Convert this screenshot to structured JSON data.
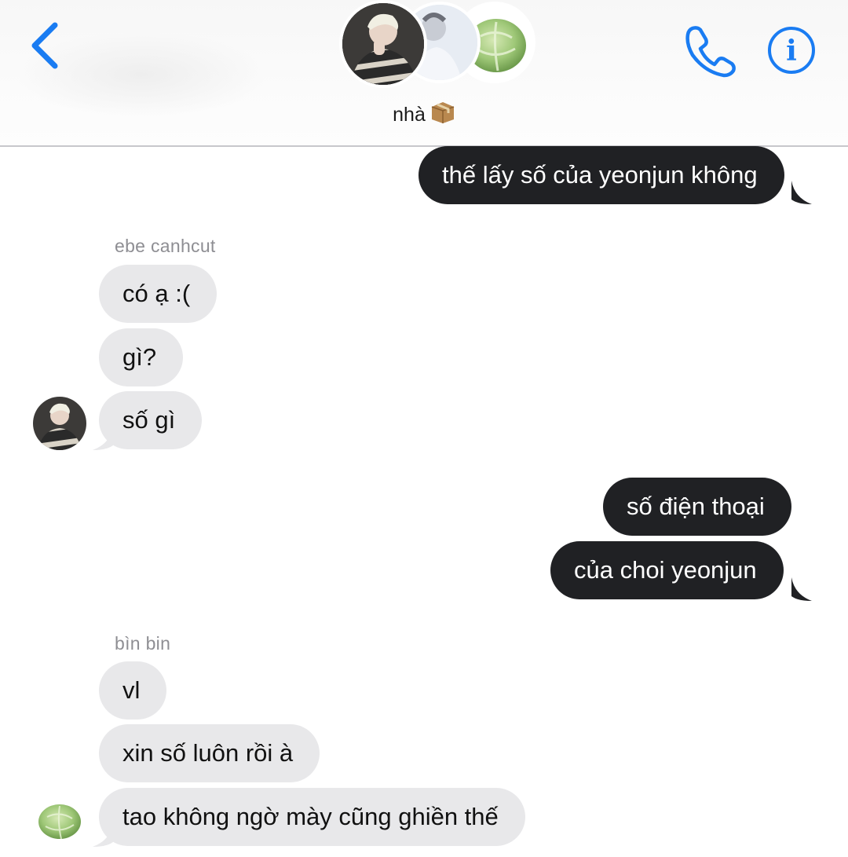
{
  "header": {
    "group_name": "nhà",
    "group_emoji": "📦",
    "back_icon": "chevron-left-icon",
    "call_icon": "phone-icon",
    "info_icon": "info-icon",
    "accent_color": "#1a7cf2"
  },
  "messages": [
    {
      "direction": "outgoing",
      "text": "thế lấy số của yeonjun không"
    },
    {
      "direction": "incoming",
      "sender": "ebe canhcut",
      "text": "có ạ :("
    },
    {
      "direction": "incoming",
      "text": "gì?"
    },
    {
      "direction": "incoming",
      "text": "số gì"
    },
    {
      "direction": "outgoing",
      "text": "số điện thoại"
    },
    {
      "direction": "outgoing",
      "text": "của choi yeonjun"
    },
    {
      "direction": "incoming",
      "sender": "bìn bin",
      "text": "vl"
    },
    {
      "direction": "incoming",
      "text": "xin số luôn rồi à"
    },
    {
      "direction": "incoming",
      "text": "tao không ngờ mày cũng ghiền thế"
    }
  ],
  "colors": {
    "outgoing_bubble": "#202124",
    "incoming_bubble": "#e8e8ea",
    "sender_label": "#8e8e93"
  }
}
